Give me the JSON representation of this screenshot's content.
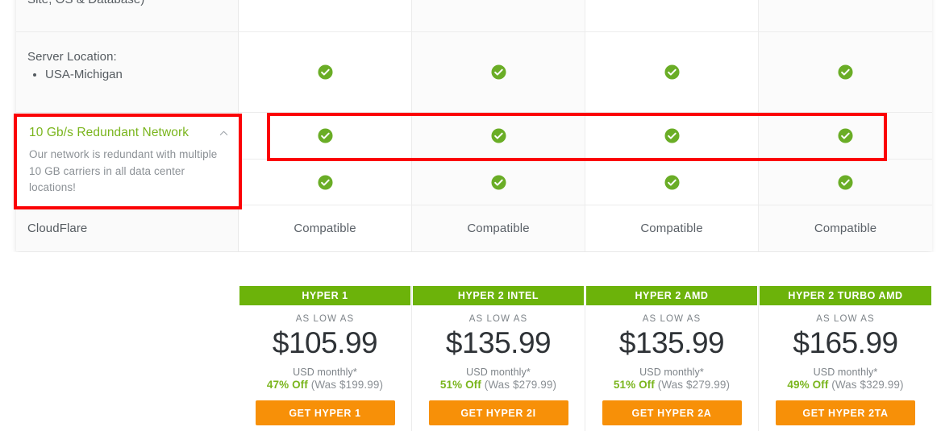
{
  "comparison_table": {
    "feature_rows": [
      {
        "id": "control-panel",
        "text": "Site, OS & Database)",
        "kind": "text"
      },
      {
        "id": "server-location",
        "text": "Server Location:",
        "kind": "list",
        "items": [
          "USA-Michigan"
        ]
      },
      {
        "id": "redundant-network",
        "text": "10 Gb/s Redundant Network",
        "kind": "popup"
      },
      {
        "id": "ddos-protection",
        "text": "",
        "kind": "text"
      },
      {
        "id": "cloudflare",
        "text": "CloudFlare",
        "kind": "text"
      }
    ],
    "feature_popup": {
      "title": "10 Gb/s Redundant Network",
      "description": "Our network is redundant with multiple 10 GB carriers in all data center locations!",
      "collapse_icon": "chevron-up-icon"
    },
    "plan_columns": [
      "HYPER 1",
      "HYPER 2 INTEL",
      "HYPER 2 AMD",
      "HYPER 2 TURBO AMD"
    ],
    "cells": [
      {
        "row": "control-panel",
        "values": [
          "",
          "",
          "",
          ""
        ]
      },
      {
        "row": "server-location",
        "values": [
          "check",
          "check",
          "check",
          "check"
        ]
      },
      {
        "row": "redundant-network",
        "values": [
          "check",
          "check",
          "check",
          "check"
        ]
      },
      {
        "row": "ddos-protection",
        "values": [
          "check",
          "check",
          "check",
          "check"
        ]
      },
      {
        "row": "cloudflare",
        "values": [
          "Compatible",
          "Compatible",
          "Compatible",
          "Compatible"
        ]
      }
    ],
    "check_icon": "green-check-circle-icon",
    "highlight_color": "#fb0105"
  },
  "pricing": {
    "cards": [
      {
        "name": "HYPER 1",
        "as_low_as": "AS LOW AS",
        "price": "$105.99",
        "currency_note": "USD monthly*",
        "discount_pct": "47% Off",
        "was": "(Was $199.99)",
        "cta": "GET HYPER 1"
      },
      {
        "name": "HYPER 2 INTEL",
        "as_low_as": "AS LOW AS",
        "price": "$135.99",
        "currency_note": "USD monthly*",
        "discount_pct": "51% Off",
        "was": "(Was $279.99)",
        "cta": "GET HYPER 2I"
      },
      {
        "name": "HYPER 2 AMD",
        "as_low_as": "AS LOW AS",
        "price": "$135.99",
        "currency_note": "USD monthly*",
        "discount_pct": "51% Off",
        "was": "(Was $279.99)",
        "cta": "GET HYPER 2A"
      },
      {
        "name": "HYPER 2 TURBO AMD",
        "as_low_as": "AS LOW AS",
        "price": "$165.99",
        "currency_note": "USD monthly*",
        "discount_pct": "49% Off",
        "was": "(Was $329.99)",
        "cta": "GET HYPER 2TA"
      }
    ]
  },
  "colors": {
    "brand_green": "#6cb30a",
    "accent_green": "#7ab51d",
    "cta_orange": "#f79008",
    "annotation_red": "#fb0105"
  }
}
